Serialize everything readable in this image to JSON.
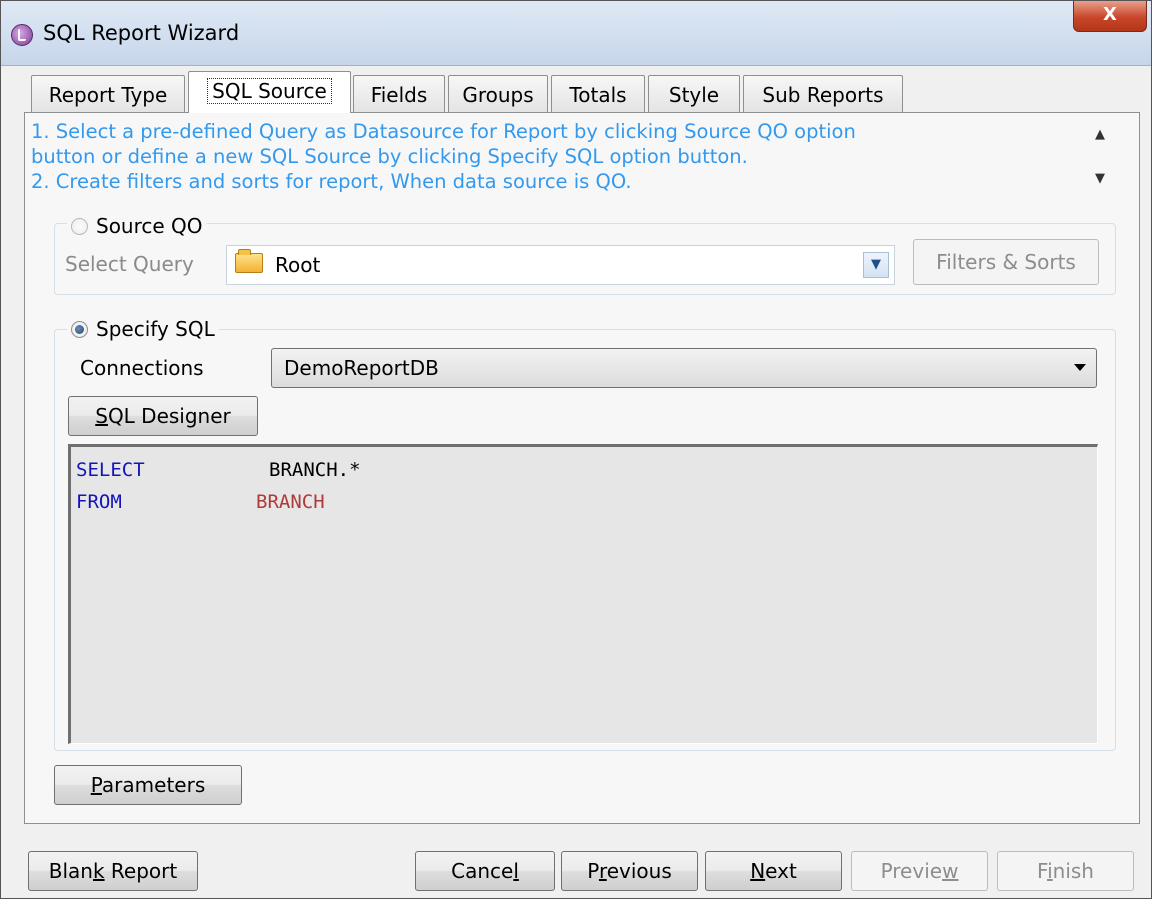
{
  "window": {
    "title": "SQL Report Wizard",
    "close_glyph": "X"
  },
  "tabs": [
    {
      "label": "Report Type"
    },
    {
      "label": "SQL Source"
    },
    {
      "label": "Fields"
    },
    {
      "label": "Groups"
    },
    {
      "label": "Totals"
    },
    {
      "label": "Style"
    },
    {
      "label": "Sub Reports"
    }
  ],
  "active_tab": "SQL Source",
  "info": {
    "line1": "1. Select a pre-defined Query as Datasource for Report by clicking Source QO option",
    "line2": "button or define a new SQL Source by clicking Specify SQL option button.",
    "line3": "2. Create filters and sorts for report, When data source is QO."
  },
  "source_qo": {
    "label": "Source QO",
    "selected": false,
    "select_query_label": "Select Query",
    "select_query_value": "Root",
    "filters_button": "Filters & Sorts"
  },
  "specify_sql": {
    "label": "Specify SQL",
    "selected": true,
    "connections_label": "Connections",
    "connection_value": "DemoReportDB",
    "designer_button": {
      "prefix": "",
      "mnemonic": "S",
      "rest": "QL Designer"
    },
    "sql": {
      "line1_kw": "SELECT",
      "line1_val": "BRANCH.*",
      "line2_kw": "FROM",
      "line2_val": "BRANCH"
    }
  },
  "parameters_button": {
    "prefix": "",
    "mnemonic": "P",
    "rest": "arameters"
  },
  "footer": {
    "blank_report": {
      "prefix": "Blan",
      "mnemonic": "k",
      "rest": " Report"
    },
    "cancel": {
      "prefix": "Cance",
      "mnemonic": "l",
      "rest": ""
    },
    "previous": {
      "prefix": "P",
      "mnemonic": "r",
      "rest": "evious"
    },
    "next": {
      "prefix": "",
      "mnemonic": "N",
      "rest": "ext"
    },
    "preview": {
      "prefix": "Previe",
      "mnemonic": "w",
      "rest": ""
    },
    "finish": {
      "prefix": "F",
      "mnemonic": "i",
      "rest": "nish"
    }
  },
  "colors": {
    "info_text": "#3399ee",
    "sql_keyword": "#1414b8",
    "sql_table": "#b03a3a"
  },
  "icons": {
    "app": "app-icon",
    "folder": "folder-icon",
    "dropdown": "chevron-down-icon"
  }
}
